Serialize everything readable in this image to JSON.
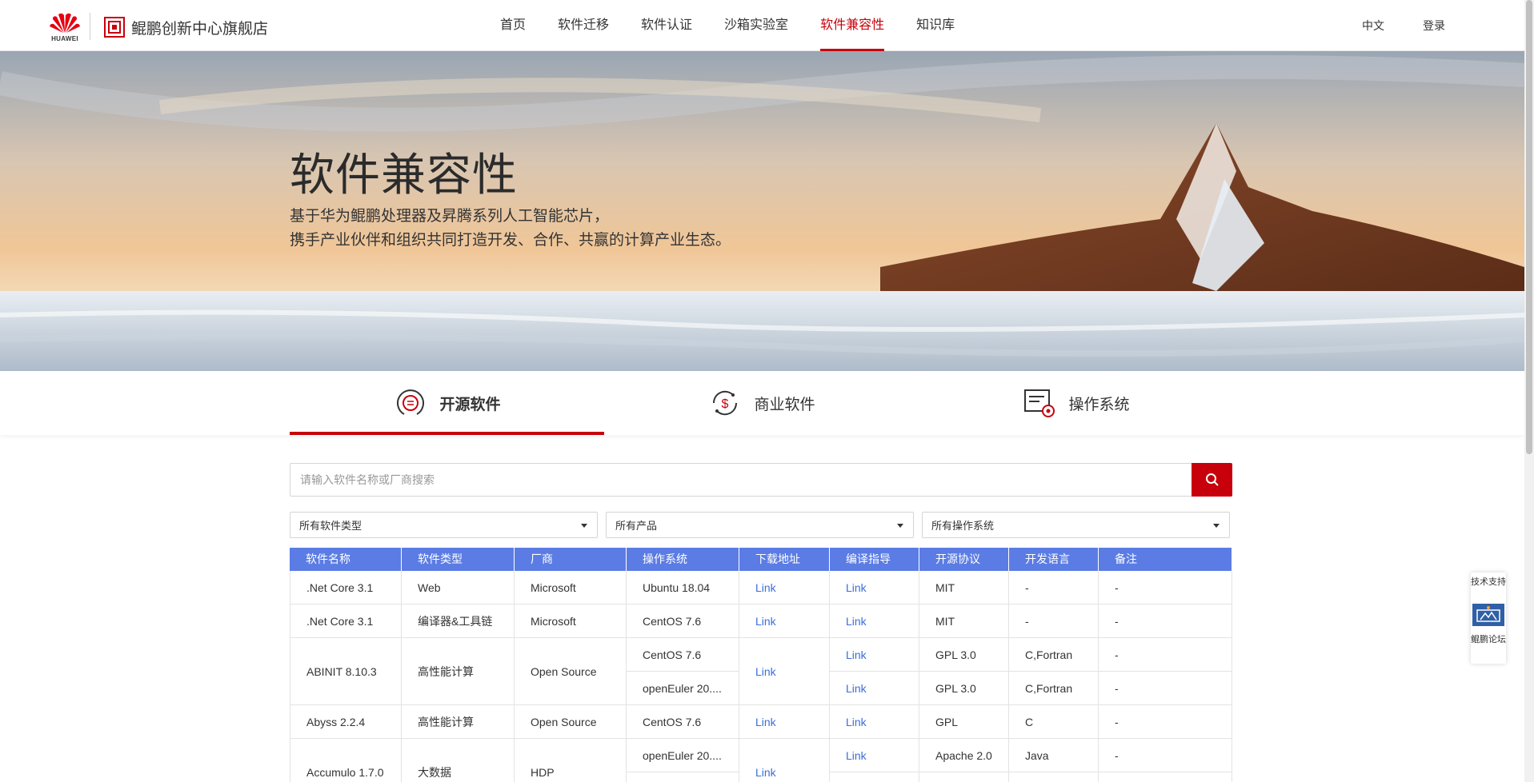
{
  "header": {
    "huawei_brand": "HUAWEI",
    "shop_name": "鲲鹏创新中心旗舰店",
    "nav": [
      {
        "label": "首页",
        "active": false
      },
      {
        "label": "软件迁移",
        "active": false
      },
      {
        "label": "软件认证",
        "active": false
      },
      {
        "label": "沙箱实验室",
        "active": false
      },
      {
        "label": "软件兼容性",
        "active": true
      },
      {
        "label": "知识库",
        "active": false
      }
    ],
    "language": "中文",
    "login": "登录",
    "accent_color": "#c7000b"
  },
  "hero": {
    "title": "软件兼容性",
    "subtitle_line1": "基于华为鲲鹏处理器及昇腾系列人工智能芯片，",
    "subtitle_line2": "携手产业伙伴和组织共同打造开发、合作、共赢的计算产业生态。"
  },
  "tabs": [
    {
      "label": "开源软件",
      "icon": "open-source-icon",
      "active": true
    },
    {
      "label": "商业软件",
      "icon": "dollar-cycle-icon",
      "active": false
    },
    {
      "label": "操作系统",
      "icon": "os-gear-icon",
      "active": false
    }
  ],
  "search": {
    "placeholder": "请输入软件名称或厂商搜索",
    "value": ""
  },
  "filters": {
    "software_type": "所有软件类型",
    "product": "所有产品",
    "os": "所有操作系统"
  },
  "table": {
    "header_color": "#5b7ce4",
    "link_color": "#3a6fd8",
    "headers": [
      "软件名称",
      "软件类型",
      "厂商",
      "操作系统",
      "下载地址",
      "编译指导",
      "开源协议",
      "开发语言",
      "备注"
    ],
    "groups": [
      {
        "name": ".Net Core 3.1",
        "type": "Web",
        "vendor": "Microsoft",
        "download": "Link",
        "rows": [
          {
            "os": "Ubuntu 18.04",
            "guide": "Link",
            "license": "MIT",
            "language": "-",
            "note": "-"
          }
        ]
      },
      {
        "name": ".Net Core 3.1",
        "type": "编译器&工具链",
        "vendor": "Microsoft",
        "download": "Link",
        "rows": [
          {
            "os": "CentOS 7.6",
            "guide": "Link",
            "license": "MIT",
            "language": "-",
            "note": "-"
          }
        ]
      },
      {
        "name": "ABINIT 8.10.3",
        "type": "高性能计算",
        "vendor": "Open Source",
        "download": "Link",
        "rows": [
          {
            "os": "CentOS 7.6",
            "guide": "Link",
            "license": "GPL 3.0",
            "language": "C,Fortran",
            "note": "-"
          },
          {
            "os": "openEuler 20....",
            "guide": "Link",
            "license": "GPL 3.0",
            "language": "C,Fortran",
            "note": "-"
          }
        ]
      },
      {
        "name": "Abyss 2.2.4",
        "type": "高性能计算",
        "vendor": "Open Source",
        "download": "Link",
        "rows": [
          {
            "os": "CentOS 7.6",
            "guide": "Link",
            "license": "GPL",
            "language": "C",
            "note": "-"
          }
        ]
      },
      {
        "name": "Accumulo 1.7.0",
        "type": "大数据",
        "vendor": "HDP",
        "download": "Link",
        "rows": [
          {
            "os": "openEuler 20....",
            "guide": "Link",
            "license": "Apache 2.0",
            "language": "Java",
            "note": "-"
          },
          {
            "os": "",
            "guide": "",
            "license": "",
            "language": "",
            "note": ""
          }
        ]
      }
    ]
  },
  "side_widget": {
    "top_label": "技术支持",
    "bottom_label": "鲲鹏论坛"
  }
}
